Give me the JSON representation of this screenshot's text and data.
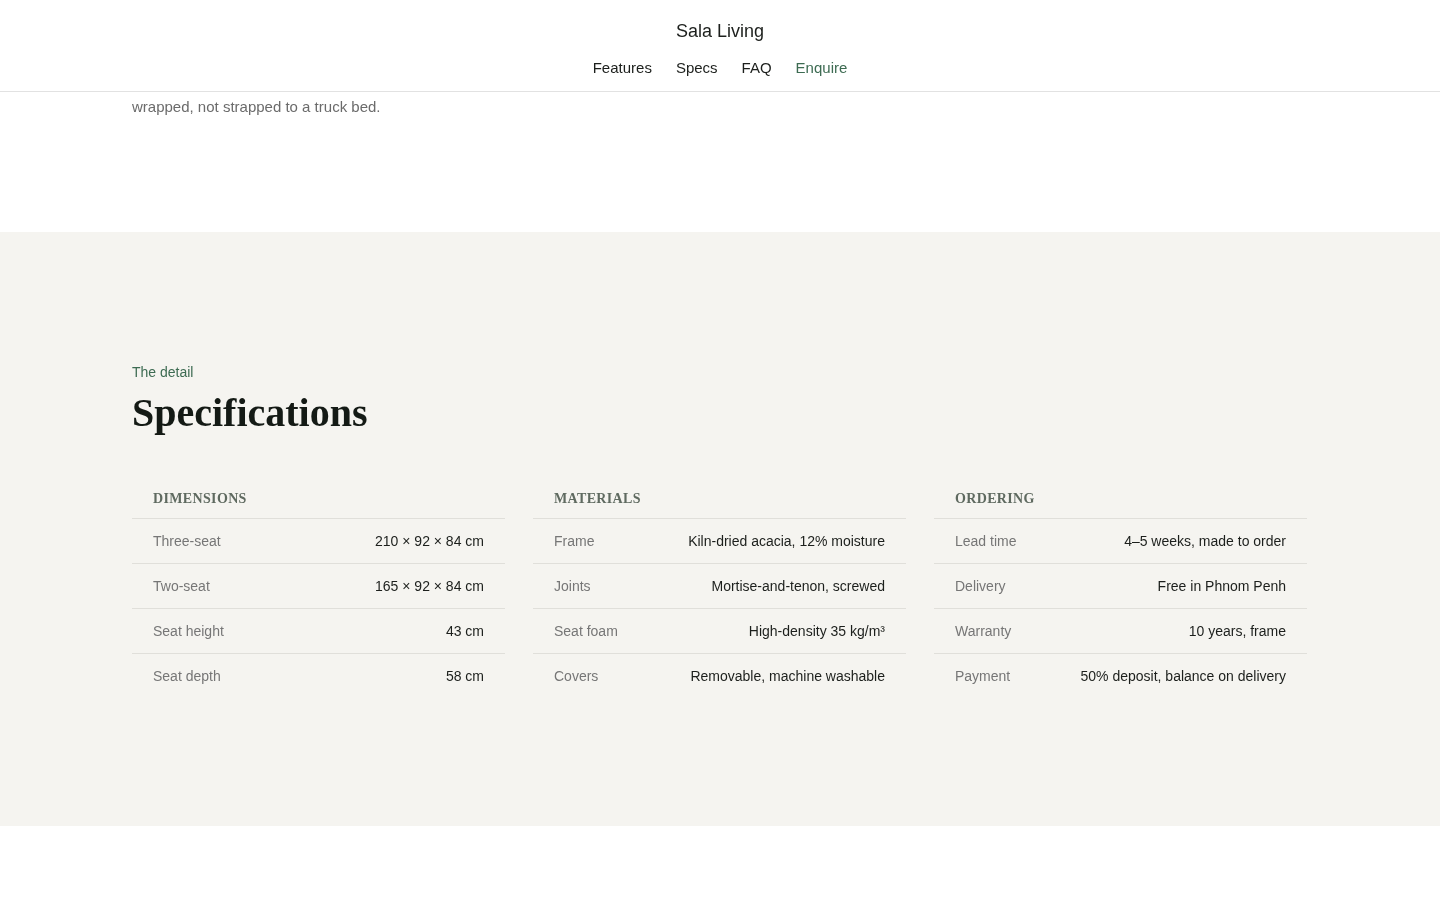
{
  "header": {
    "brand": "Sala Living",
    "nav": [
      {
        "label": "Features",
        "selected": false
      },
      {
        "label": "Specs",
        "selected": false
      },
      {
        "label": "FAQ",
        "selected": false
      },
      {
        "label": "Enquire",
        "selected": true
      }
    ]
  },
  "intro": {
    "text": "wrapped, not strapped to a truck bed."
  },
  "specs": {
    "eyebrow": "The detail",
    "title": "Specifications",
    "groups": [
      {
        "heading": "DIMENSIONS",
        "rows": [
          {
            "label": "Three-seat",
            "value": "210 × 92 × 84 cm"
          },
          {
            "label": "Two-seat",
            "value": "165 × 92 × 84 cm"
          },
          {
            "label": "Seat height",
            "value": "43 cm"
          },
          {
            "label": "Seat depth",
            "value": "58 cm"
          }
        ]
      },
      {
        "heading": "MATERIALS",
        "rows": [
          {
            "label": "Frame",
            "value": "Kiln-dried acacia, 12% moisture"
          },
          {
            "label": "Joints",
            "value": "Mortise-and-tenon, screwed"
          },
          {
            "label": "Seat foam",
            "value": "High-density 35 kg/m³"
          },
          {
            "label": "Covers",
            "value": "Removable, machine washable"
          }
        ]
      },
      {
        "heading": "ORDERING",
        "rows": [
          {
            "label": "Lead time",
            "value": "4–5 weeks, made to order"
          },
          {
            "label": "Delivery",
            "value": "Free in Phnom Penh"
          },
          {
            "label": "Warranty",
            "value": "10 years, frame"
          },
          {
            "label": "Payment",
            "value": "50% deposit, balance on delivery"
          }
        ]
      }
    ]
  }
}
